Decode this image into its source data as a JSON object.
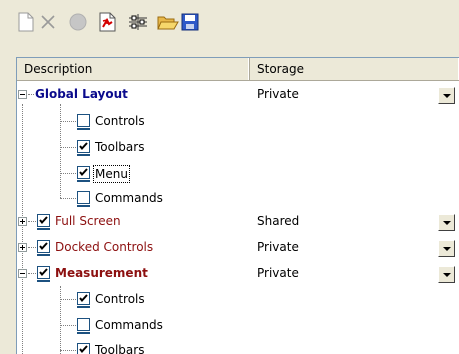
{
  "toolbar": {
    "buttons": [
      {
        "name": "new-document-icon",
        "enabled": false
      },
      {
        "name": "delete-icon",
        "enabled": false
      },
      {
        "name": "record-icon",
        "enabled": false
      },
      {
        "name": "reset-icon",
        "enabled": true
      },
      {
        "name": "customize-icon",
        "enabled": true
      },
      {
        "name": "open-folder-icon",
        "enabled": true
      },
      {
        "name": "save-icon",
        "enabled": true
      }
    ]
  },
  "columns": {
    "description": "Description",
    "storage": "Storage"
  },
  "tree": {
    "global_layout": {
      "label": "Global Layout",
      "storage": "Private",
      "expanded": true
    },
    "global_controls": {
      "label": "Controls",
      "checked": false
    },
    "global_toolbars": {
      "label": "Toolbars",
      "checked": true
    },
    "global_menu": {
      "label": "Menu",
      "checked": true,
      "selected": true
    },
    "global_commands": {
      "label": "Commands",
      "checked": false
    },
    "full_screen": {
      "label": "Full Screen",
      "storage": "Shared",
      "checked": true,
      "expanded": false
    },
    "docked_controls": {
      "label": "Docked Controls",
      "storage": "Private",
      "checked": true,
      "expanded": false
    },
    "measurement": {
      "label": "Measurement",
      "storage": "Private",
      "checked": true,
      "expanded": true
    },
    "meas_controls": {
      "label": "Controls",
      "checked": true
    },
    "meas_commands": {
      "label": "Commands",
      "checked": false
    },
    "meas_toolbars": {
      "label": "Toolbars",
      "checked": true
    }
  },
  "colors": {
    "blue_item": "#0a0a8c",
    "red_item": "#8c0f0f",
    "panel_border": "#7f9db9"
  }
}
